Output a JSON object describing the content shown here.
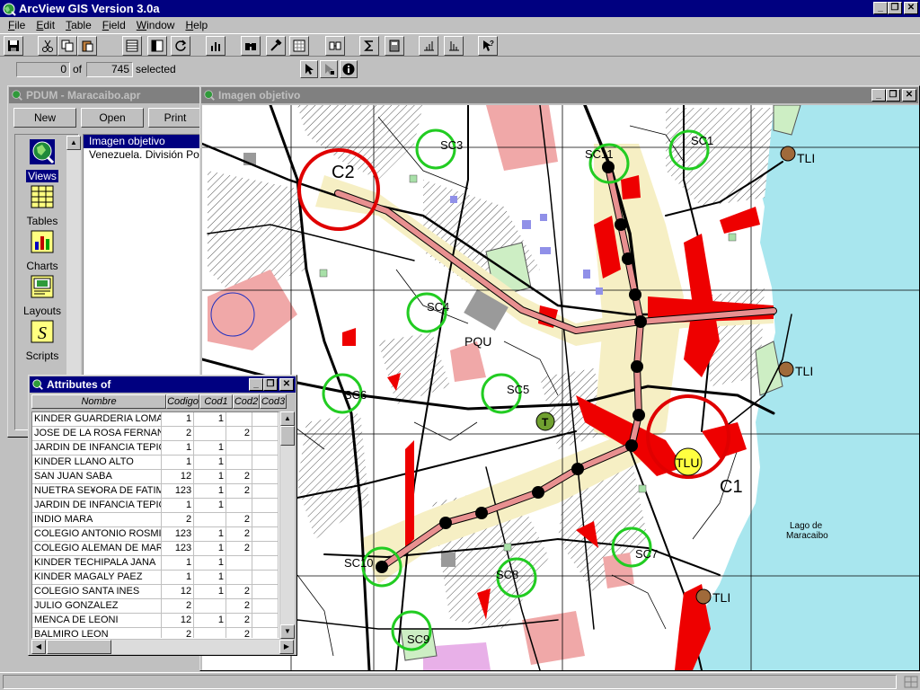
{
  "app": {
    "title": "ArcView GIS Version 3.0a",
    "window_buttons": {
      "minimize": "_",
      "restore": "❐",
      "close": "✕"
    }
  },
  "menu": [
    {
      "label": "File",
      "key": "F",
      "rest": "ile"
    },
    {
      "label": "Edit",
      "key": "E",
      "rest": "dit"
    },
    {
      "label": "Table",
      "key": "T",
      "rest": "able"
    },
    {
      "label": "Field",
      "key": "F",
      "rest": "ield"
    },
    {
      "label": "Window",
      "key": "W",
      "rest": "indow"
    },
    {
      "label": "Help",
      "key": "H",
      "rest": "elp"
    }
  ],
  "toolbar": {
    "icons": [
      "save-icon",
      "cut-icon",
      "copy-icon",
      "paste-icon",
      "table-properties-icon",
      "select-all-icon",
      "refresh-icon",
      "chart-icon",
      "find-icon",
      "query-icon",
      "promote-icon",
      "join-icon",
      "summarize-icon",
      "calculate-icon",
      "sort-ascending-icon",
      "sort-descending-icon",
      "help-pointer-icon"
    ]
  },
  "selection": {
    "selected_count": "0",
    "of_label": "of",
    "total_count": "745",
    "selected_label": "selected"
  },
  "project": {
    "title": "PDUM - Maracaibo.apr",
    "buttons": {
      "new": "New",
      "open": "Open",
      "print": "Print"
    },
    "doc_types": [
      {
        "label": "Views",
        "icon": "views-icon"
      },
      {
        "label": "Tables",
        "icon": "tables-icon"
      },
      {
        "label": "Charts",
        "icon": "charts-icon"
      },
      {
        "label": "Layouts",
        "icon": "layouts-icon"
      },
      {
        "label": "Scripts",
        "icon": "scripts-icon"
      }
    ],
    "documents": [
      "Imagen objetivo",
      "Venezuela. División Política"
    ]
  },
  "view": {
    "title": "Imagen objetivo",
    "labels": {
      "sc1": "SC1",
      "sc11": "SC11",
      "sc3": "SC3",
      "sc4": "SC4",
      "sc5": "SC5",
      "sc6": "SC6",
      "sc7": "SC7",
      "sc8": "SC8",
      "sc9": "SC9",
      "sc10": "SC10",
      "c2": "C2",
      "c1": "C1",
      "pqu": "PQU",
      "tlu": "TLU",
      "t": "T",
      "tli_top": "TLI",
      "tli_mid": "TLI",
      "tli_bottom": "TLI",
      "lake_1": "Lago de",
      "lake_2": "Maracaibo"
    },
    "colors": {
      "water": "#a8e6ee",
      "centre_ring": "#e00000",
      "subcentre_ring": "#22cc22",
      "corridor": "#e89090",
      "station": "#000000",
      "commercial": "#ee0000",
      "park": "#cdeec4",
      "institutional": "#f0a8a8",
      "residential": "#f6efc4"
    }
  },
  "attributes": {
    "title": "Attributes of",
    "columns": [
      "Nombre",
      "Codigo",
      "Cod1",
      "Cod2",
      "Cod3"
    ],
    "rows": [
      [
        "KINDER GUARDERIA LOMA LINDA",
        "1",
        "1",
        "",
        ""
      ],
      [
        "JOSE DE LA ROSA FERNANDEZ",
        "2",
        "",
        "2",
        ""
      ],
      [
        "JARDIN DE INFANCIA TEPICHIA",
        "1",
        "1",
        "",
        ""
      ],
      [
        "KINDER LLANO ALTO",
        "1",
        "1",
        "",
        ""
      ],
      [
        "SAN JUAN SABA",
        "12",
        "1",
        "2",
        ""
      ],
      [
        "NUETRA SE¥ORA DE FATIMA",
        "123",
        "1",
        "2",
        ""
      ],
      [
        "JARDIN DE INFANCIA TEPICHIA",
        "1",
        "1",
        "",
        ""
      ],
      [
        "INDIO MARA",
        "2",
        "",
        "2",
        ""
      ],
      [
        "COLEGIO ANTONIO ROSMINI",
        "123",
        "1",
        "2",
        ""
      ],
      [
        "COLEGIO ALEMAN DE MARACAIBO",
        "123",
        "1",
        "2",
        ""
      ],
      [
        "KINDER TECHIPALA JANA",
        "1",
        "1",
        "",
        ""
      ],
      [
        "KINDER MAGALY PAEZ",
        "1",
        "1",
        "",
        ""
      ],
      [
        "COLEGIO SANTA INES",
        "12",
        "1",
        "2",
        ""
      ],
      [
        "JULIO GONZALEZ",
        "2",
        "",
        "2",
        ""
      ],
      [
        "MENCA DE LEONI",
        "12",
        "1",
        "2",
        ""
      ],
      [
        "BALMIRO LEON",
        "2",
        "",
        "2",
        ""
      ]
    ]
  }
}
